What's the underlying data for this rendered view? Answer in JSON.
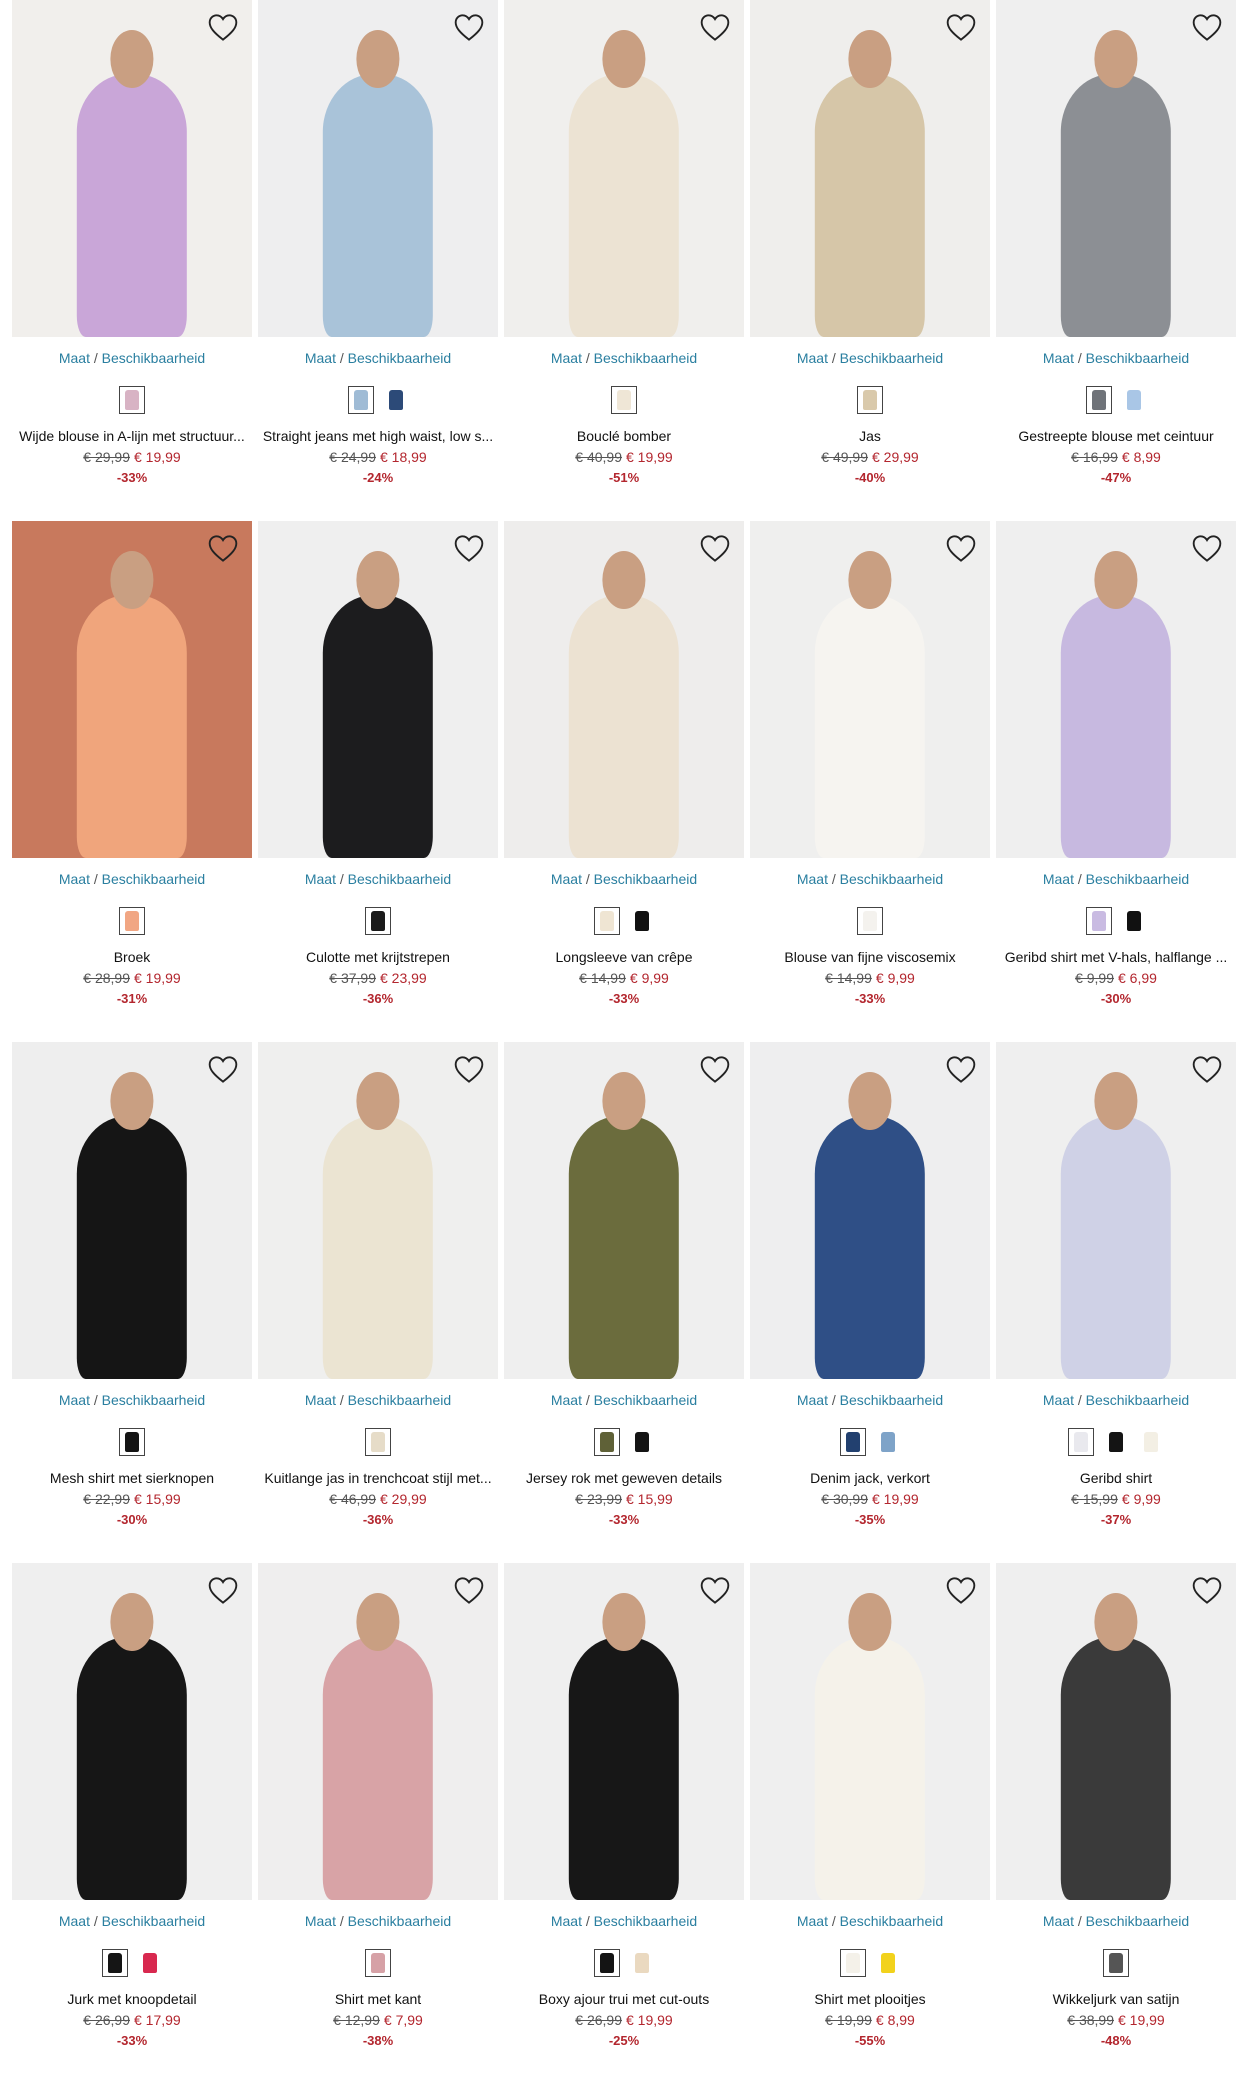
{
  "size_link": {
    "maat": "Maat",
    "sep": "/",
    "availability": "Beschikbaarheid"
  },
  "products": [
    {
      "name": "Wijde blouse in A-lijn met structuur...",
      "old_price": "€ 29,99",
      "new_price": "€ 19,99",
      "discount": "-33%",
      "bg": "#f1efec",
      "figure": "#c9a6d8",
      "swatches": [
        "#d8b3c4"
      ]
    },
    {
      "name": "Straight jeans met high waist, low s...",
      "old_price": "€ 24,99",
      "new_price": "€ 18,99",
      "discount": "-24%",
      "bg": "#eeeeef",
      "figure": "#a9c3d9",
      "swatches": [
        "#9fbbd5",
        "#2c4a78"
      ]
    },
    {
      "name": "Bouclé bomber",
      "old_price": "€ 40,99",
      "new_price": "€ 19,99",
      "discount": "-51%",
      "bg": "#f0efed",
      "figure": "#ece3d3",
      "swatches": [
        "#efe6d6"
      ]
    },
    {
      "name": "Jas",
      "old_price": "€ 49,99",
      "new_price": "€ 29,99",
      "discount": "-40%",
      "bg": "#efeeec",
      "figure": "#d6c6a8",
      "swatches": [
        "#d9c9ab"
      ]
    },
    {
      "name": "Gestreepte blouse met ceintuur",
      "old_price": "€ 16,99",
      "new_price": "€ 8,99",
      "discount": "-47%",
      "bg": "#efefef",
      "figure": "#8c8f94",
      "swatches": [
        "#6f7379",
        "#a9c6e6"
      ]
    },
    {
      "name": "Broek",
      "old_price": "€ 28,99",
      "new_price": "€ 19,99",
      "discount": "-31%",
      "bg": "#c8795d",
      "figure": "#f0a57c",
      "swatches": [
        "#f1a683"
      ]
    },
    {
      "name": "Culotte met krijtstrepen",
      "old_price": "€ 37,99",
      "new_price": "€ 23,99",
      "discount": "-36%",
      "bg": "#efefef",
      "figure": "#1c1c1e",
      "swatches": [
        "#1a1a1a"
      ]
    },
    {
      "name": "Longsleeve van crêpe",
      "old_price": "€ 14,99",
      "new_price": "€ 9,99",
      "discount": "-33%",
      "bg": "#eeedec",
      "figure": "#ece2d2",
      "swatches": [
        "#efe5d3",
        "#111111"
      ]
    },
    {
      "name": "Blouse van fijne viscosemix",
      "old_price": "€ 14,99",
      "new_price": "€ 9,99",
      "discount": "-33%",
      "bg": "#efefee",
      "figure": "#f6f4f0",
      "swatches": [
        "#f4f2ee"
      ]
    },
    {
      "name": "Geribd shirt met V-hals, halflange ...",
      "old_price": "€ 9,99",
      "new_price": "€ 6,99",
      "discount": "-30%",
      "bg": "#efefef",
      "figure": "#c7b9e0",
      "swatches": [
        "#c9bbe2",
        "#111111"
      ]
    },
    {
      "name": "Mesh shirt met sierknopen",
      "old_price": "€ 22,99",
      "new_price": "€ 15,99",
      "discount": "-30%",
      "bg": "#eeeeee",
      "figure": "#151515",
      "swatches": [
        "#141414"
      ]
    },
    {
      "name": "Kuitlange jas in trenchcoat stijl met...",
      "old_price": "€ 46,99",
      "new_price": "€ 29,99",
      "discount": "-36%",
      "bg": "#efefee",
      "figure": "#ebe4d2",
      "swatches": [
        "#e6dcc8"
      ]
    },
    {
      "name": "Jersey rok met geweven details",
      "old_price": "€ 23,99",
      "new_price": "€ 15,99",
      "discount": "-33%",
      "bg": "#efefef",
      "figure": "#6b6c3d",
      "swatches": [
        "#5f6137",
        "#141414"
      ]
    },
    {
      "name": "Denim jack, verkort",
      "old_price": "€ 30,99",
      "new_price": "€ 19,99",
      "discount": "-35%",
      "bg": "#eeeeef",
      "figure": "#2f4f86",
      "swatches": [
        "#22406f",
        "#7ea3c8"
      ]
    },
    {
      "name": "Geribd shirt",
      "old_price": "€ 15,99",
      "new_price": "€ 9,99",
      "discount": "-37%",
      "bg": "#efefef",
      "figure": "#cfd1e6",
      "swatches": [
        "#e9e9ee",
        "#141414",
        "#f3efe4"
      ]
    },
    {
      "name": "Jurk met knoopdetail",
      "old_price": "€ 26,99",
      "new_price": "€ 17,99",
      "discount": "-33%",
      "bg": "#efefef",
      "figure": "#161616",
      "swatches": [
        "#151515",
        "#d8284f"
      ]
    },
    {
      "name": "Shirt met kant",
      "old_price": "€ 12,99",
      "new_price": "€ 7,99",
      "discount": "-38%",
      "bg": "#efeeee",
      "figure": "#d8a3a6",
      "swatches": [
        "#d6a1a6"
      ]
    },
    {
      "name": "Boxy ajour trui met cut-outs",
      "old_price": "€ 26,99",
      "new_price": "€ 19,99",
      "discount": "-25%",
      "bg": "#efefef",
      "figure": "#171717",
      "swatches": [
        "#141414",
        "#ead9c0"
      ]
    },
    {
      "name": "Shirt met plooitjes",
      "old_price": "€ 19,99",
      "new_price": "€ 8,99",
      "discount": "-55%",
      "bg": "#efefef",
      "figure": "#f5f2ea",
      "swatches": [
        "#f4f1e9",
        "#f2d21c"
      ]
    },
    {
      "name": "Wikkeljurk van satijn",
      "old_price": "€ 38,99",
      "new_price": "€ 19,99",
      "discount": "-48%",
      "bg": "#efefef",
      "figure": "#3a3a3a",
      "swatches": [
        "#555555"
      ]
    }
  ]
}
